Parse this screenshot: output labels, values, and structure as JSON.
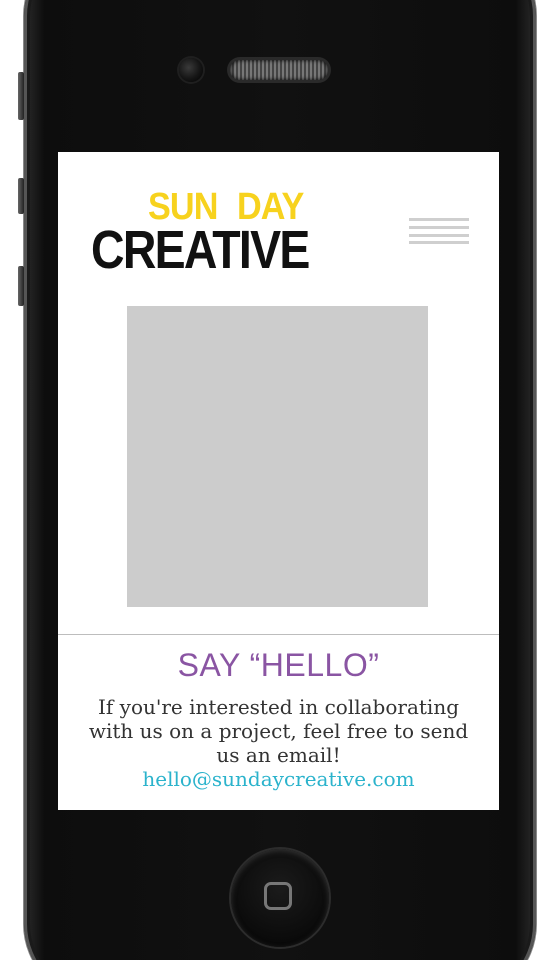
{
  "header": {
    "logo": {
      "sun": "SUN",
      "day": "DAY",
      "creative": "CREATIVE"
    },
    "menu_icon": "hamburger-menu-icon"
  },
  "hero": {
    "image_placeholder_color": "#cccccc"
  },
  "contact": {
    "title": "SAY “HELLO”",
    "body": "If you're interested in collaborating with us on a project, feel free to send us an email!",
    "email": "hello@sundaycreative.com"
  },
  "colors": {
    "logo_yellow": "#f7d21e",
    "logo_black": "#111111",
    "title_purple": "#8a55a3",
    "link_cyan": "#2bb3cc",
    "phone_body": "#111111"
  },
  "device": {
    "home_button_icon": "home-square-icon",
    "camera_icon": "front-camera-icon",
    "speaker_icon": "earpiece-speaker-icon"
  }
}
